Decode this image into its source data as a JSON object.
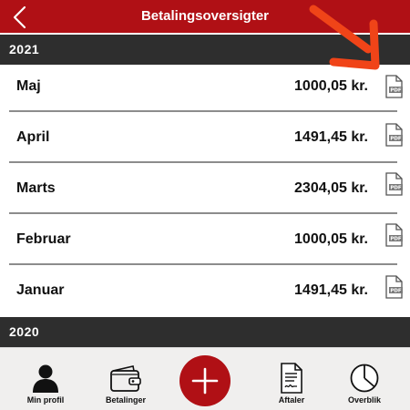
{
  "header": {
    "title": "Betalingsoversigter",
    "back_icon": "chevron-left-icon"
  },
  "colors": {
    "brand_red": "#b01015",
    "section_dark": "#2e2e2e",
    "annotation_arrow": "#f04418"
  },
  "sections": [
    {
      "year": "2021",
      "rows": [
        {
          "month": "Maj",
          "amount": "1000,05 kr."
        },
        {
          "month": "April",
          "amount": "1491,45 kr."
        },
        {
          "month": "Marts",
          "amount": "2304,05 kr."
        },
        {
          "month": "Februar",
          "amount": "1000,05 kr."
        },
        {
          "month": "Januar",
          "amount": "1491,45 kr."
        }
      ]
    },
    {
      "year": "2020",
      "rows": []
    }
  ],
  "pdf_icon_label": "PDF",
  "tabbar": {
    "items": [
      {
        "label": "Min profil",
        "icon": "person-icon"
      },
      {
        "label": "Betalinger",
        "icon": "wallet-icon"
      },
      {
        "label": "",
        "icon": "plus-icon"
      },
      {
        "label": "Aftaler",
        "icon": "document-icon"
      },
      {
        "label": "Overblik",
        "icon": "pie-chart-icon"
      }
    ]
  }
}
